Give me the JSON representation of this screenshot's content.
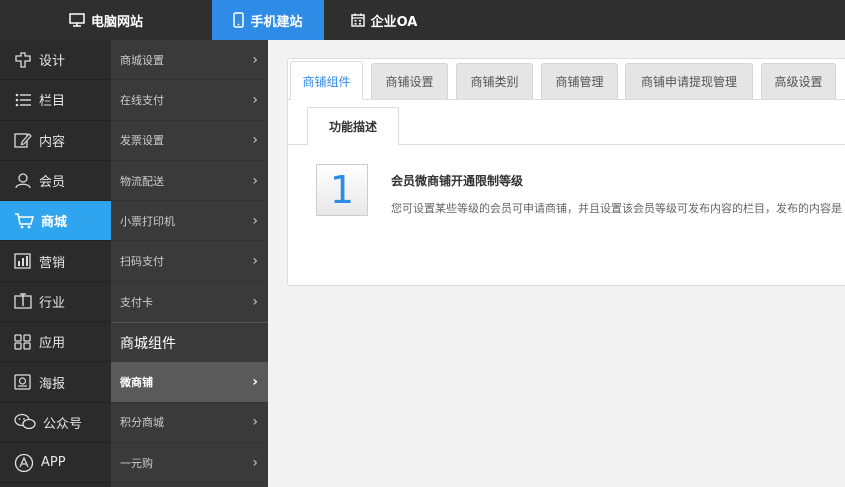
{
  "topnav": [
    {
      "label": "电脑网站",
      "icon": "monitor-icon",
      "active": false
    },
    {
      "label": "手机建站",
      "icon": "phone-icon",
      "active": true
    },
    {
      "label": "企业OA",
      "icon": "calendar-icon",
      "active": false
    }
  ],
  "sidebar1": [
    {
      "label": "设计",
      "icon": "design-icon"
    },
    {
      "label": "栏目",
      "icon": "list-icon"
    },
    {
      "label": "内容",
      "icon": "edit-icon"
    },
    {
      "label": "会员",
      "icon": "user-icon"
    },
    {
      "label": "商城",
      "icon": "cart-icon",
      "active": true
    },
    {
      "label": "营销",
      "icon": "chart-icon"
    },
    {
      "label": "行业",
      "icon": "industry-icon"
    },
    {
      "label": "应用",
      "icon": "apps-icon"
    },
    {
      "label": "海报",
      "icon": "poster-icon"
    },
    {
      "label": "公众号",
      "icon": "wechat-icon"
    },
    {
      "label": "APP",
      "icon": "appstore-icon"
    }
  ],
  "sidebar2": {
    "items_top": [
      "商城设置",
      "在线支付",
      "发票设置",
      "物流配送",
      "小票打印机",
      "扫码支付",
      "支付卡"
    ],
    "section_title": "商城组件",
    "items_bottom": [
      {
        "label": "微商铺",
        "active": true
      },
      {
        "label": "积分商城",
        "active": false
      },
      {
        "label": "一元购",
        "active": false
      }
    ]
  },
  "tabs": [
    "商铺组件",
    "商铺设置",
    "商铺类别",
    "商铺管理",
    "商铺申请提现管理",
    "高级设置"
  ],
  "subtab": "功能描述",
  "feature": {
    "number": "1",
    "title": "会员微商铺开通限制等级",
    "desc": "您可设置某些等级的会员可申请商铺，并且设置该会员等级可发布内容的栏目，发布的内容是"
  },
  "colors": {
    "accent": "#2e8be6",
    "active_side": "#30a5ef"
  }
}
